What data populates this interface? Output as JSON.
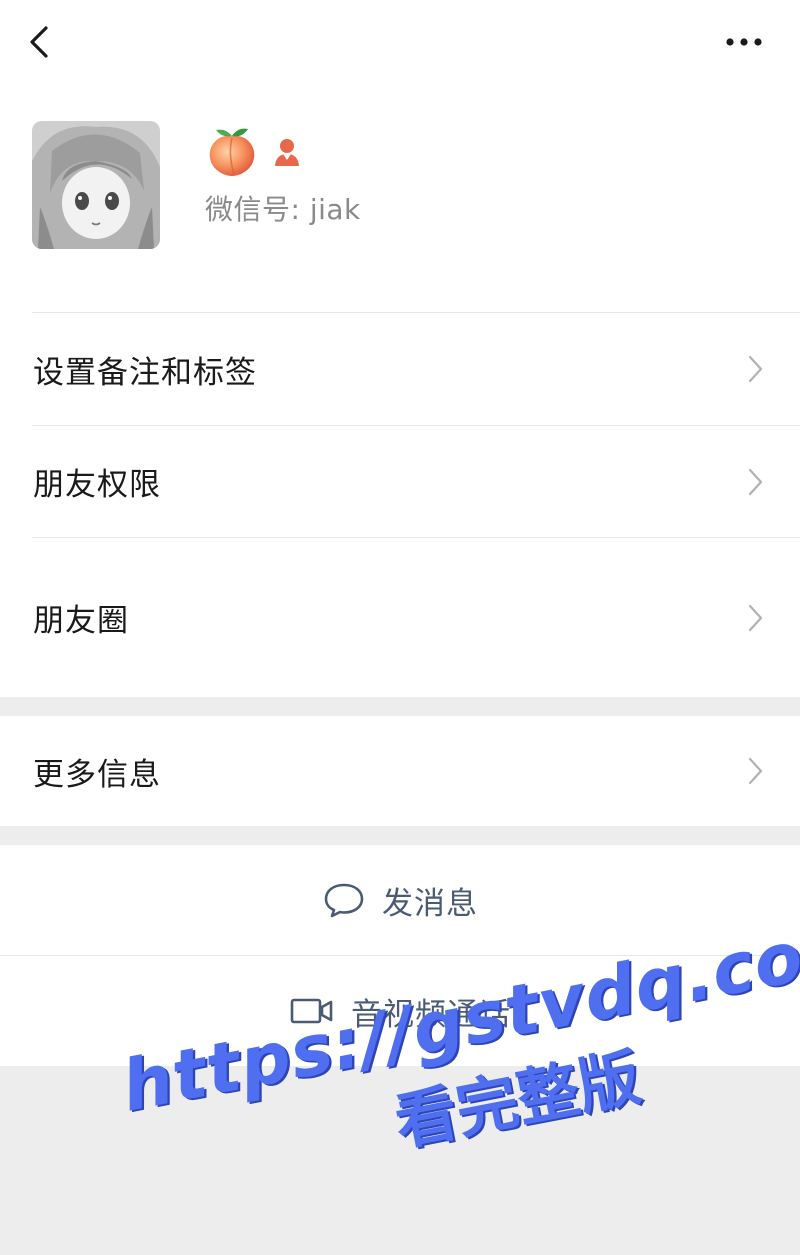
{
  "header": {
    "back_icon": "chevron-left-icon",
    "more_icon": "more-horizontal-icon"
  },
  "profile": {
    "nickname_emoji": "🍑",
    "gender_icon": "female-icon",
    "wechat_id": "微信号: jiak"
  },
  "menu": {
    "remark_tags": "设置备注和标签",
    "friend_permissions": "朋友权限",
    "moments": "朋友圈",
    "more_info": "更多信息"
  },
  "actions": {
    "send_message": "发消息",
    "av_call": "音视频通话"
  },
  "watermark": {
    "url": "https://gstvdq.com",
    "text": "看完整版"
  },
  "colors": {
    "accent_text": "#4a5b73",
    "watermark": "#4f6ff0",
    "background": "#ededed"
  }
}
